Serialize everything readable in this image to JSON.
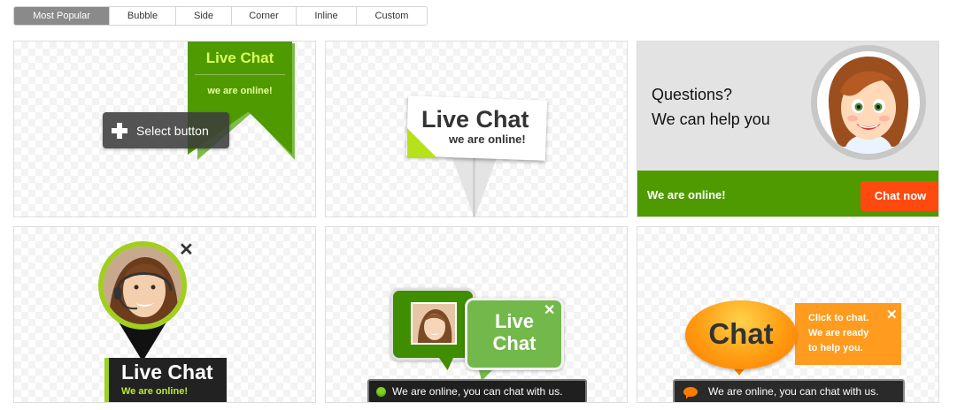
{
  "tabs": [
    {
      "label": "Most Popular",
      "active": true
    },
    {
      "label": "Bubble",
      "active": false
    },
    {
      "label": "Side",
      "active": false
    },
    {
      "label": "Corner",
      "active": false
    },
    {
      "label": "Inline",
      "active": false
    },
    {
      "label": "Custom",
      "active": false
    }
  ],
  "tiles": {
    "ribbon": {
      "title": "Live Chat",
      "subtitle": "we are online!",
      "overlay_button": "Select button",
      "overlay_icon": "plus-icon"
    },
    "bubble": {
      "title": "Live Chat",
      "subtitle": "we are online!"
    },
    "questions": {
      "line1": "Questions?",
      "line2": "We can help you",
      "status": "We are online!",
      "button": "Chat now"
    },
    "pin": {
      "title": "Live Chat",
      "subtitle": "We are online!",
      "close": "✕"
    },
    "two_bubbles": {
      "title_line1": "Live",
      "title_line2": "Chat",
      "close": "✕",
      "status_bar": "We are online, you can chat with us."
    },
    "orange": {
      "bubble_text": "Chat",
      "line1": "Click to chat.",
      "line2": "We are ready",
      "line3": "to help you.",
      "close": "✕",
      "status_bar": "We are online, you can chat with us."
    }
  },
  "colors": {
    "active_tab": "#8a8a8a",
    "green": "#4f9a00",
    "lime": "#b7e21b",
    "orange": "#ff9b1e",
    "chat_now": "#ff4a0f"
  }
}
